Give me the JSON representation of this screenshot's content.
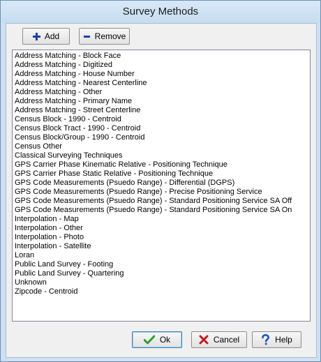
{
  "window": {
    "title": "Survey Methods"
  },
  "toolbar": {
    "add_label": "Add",
    "remove_label": "Remove"
  },
  "list": {
    "items": [
      "Address Matching - Block Face",
      "Address Matching - Digitized",
      "Address Matching - House Number",
      "Address Matching - Nearest Centerline",
      "Address Matching - Other",
      "Address Matching - Primary Name",
      "Address Matching - Street Centerline",
      "Census Block - 1990 - Centroid",
      "Census Block Tract - 1990 - Centroid",
      "Census Block/Group - 1990 - Centroid",
      "Census Other",
      "Classical Surveying Techniques",
      "GPS Carrier Phase Kinematic Relative - Positioning Technique",
      "GPS Carrier Phase Static Relative - Positioning Technique",
      "GPS Code Measurements (Psuedo Range) - Differential (DGPS)",
      "GPS Code Measurements (Psuedo Range) - Precise Positioning Service",
      "GPS Code Measurements (Psuedo Range) - Standard Positioning Service SA Off",
      "GPS Code Measurements (Psuedo Range) - Standard Positioning Service SA On",
      "Interpolation - Map",
      "Interpolation - Other",
      "Interpolation - Photo",
      "Interpolation - Satellite",
      "Loran",
      "Public Land Survey - Footing",
      "Public Land Survey - Quartering",
      "Unknown",
      "Zipcode - Centroid"
    ]
  },
  "footer": {
    "ok_label": "Ok",
    "cancel_label": "Cancel",
    "help_label": "Help"
  },
  "icons": {
    "add": "plus-icon",
    "remove": "minus-icon",
    "ok": "checkmark-icon",
    "cancel": "x-icon",
    "help": "question-mark-icon"
  },
  "colors": {
    "title_bar": "#cfe0f3",
    "plus_minus": "#1c3fa8",
    "checkmark": "#2e9d2e",
    "cancel_x": "#c3171b",
    "help_question": "#1c56c9"
  }
}
